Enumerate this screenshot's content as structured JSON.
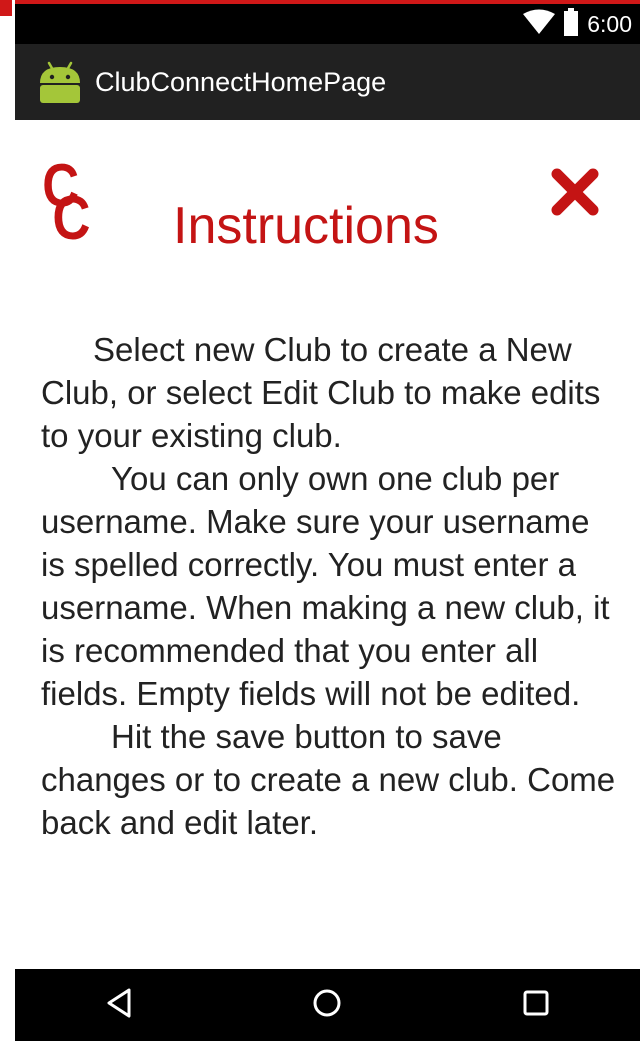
{
  "status_bar": {
    "time": "6:00",
    "icons": [
      "wifi-icon",
      "battery-icon"
    ]
  },
  "action_bar": {
    "app_icon": "android-icon",
    "title": "ClubConnectHomePage"
  },
  "dialog": {
    "logo_letters": [
      "C",
      "C"
    ],
    "heading": "Instructions",
    "close_icon": "close-icon",
    "paragraphs": [
      "Select new Club to create a New Club, or select Edit Club to make edits to your existing club.",
      "You can only own one club per username. Make sure your username is spelled correctly. You must enter a username. When making a new club, it is recommended that you enter all fields. Empty fields will not be edited.",
      "Hit the save button to save changes or to create a new club. Come back and edit later."
    ]
  },
  "nav_bar": {
    "buttons": [
      "back-icon",
      "home-icon",
      "recents-icon"
    ]
  },
  "colors": {
    "accent_red": "#c41414",
    "status_bar_bg": "#000000",
    "action_bar_bg": "#212121",
    "android_green": "#a4c639"
  }
}
